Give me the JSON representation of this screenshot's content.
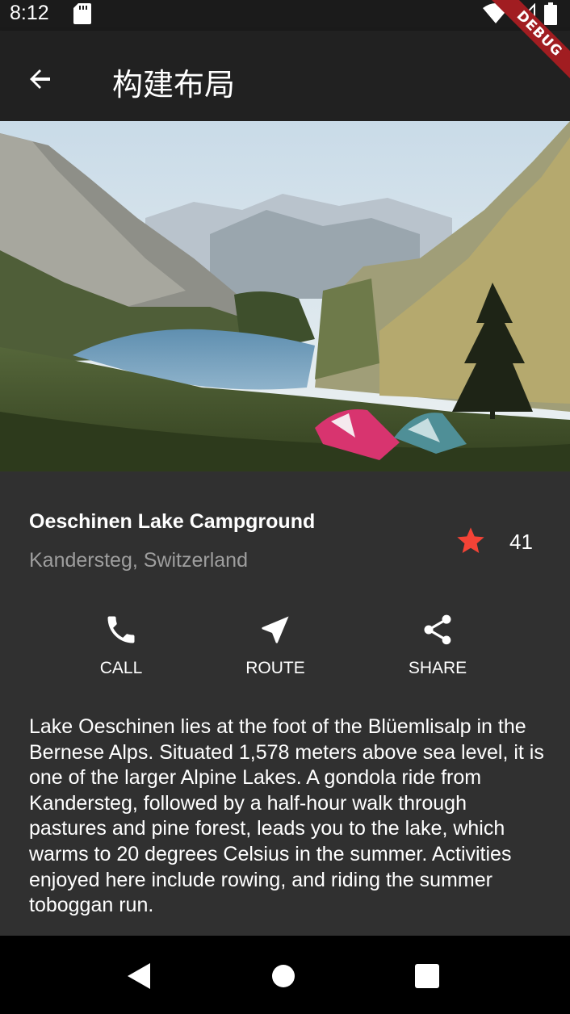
{
  "status_bar": {
    "time": "8:12"
  },
  "app_bar": {
    "title": "构建布局"
  },
  "debug_banner": {
    "label": "DEBUG"
  },
  "place": {
    "name": "Oeschinen Lake Campground",
    "location": "Kandersteg, Switzerland",
    "rating_count": "41",
    "star_color": "#f44336"
  },
  "actions": [
    {
      "label": "CALL",
      "icon": "phone-icon"
    },
    {
      "label": "ROUTE",
      "icon": "near-me-icon"
    },
    {
      "label": "SHARE",
      "icon": "share-icon"
    }
  ],
  "description": "Lake Oeschinen lies at the foot of the Blüemlisalp in the Bernese Alps. Situated 1,578 meters above sea level, it is one of the larger Alpine Lakes. A gondola ride from Kandersteg, followed by a half-hour walk through pastures and pine forest, leads you to the lake, which warms to 20 degrees Celsius in the summer. Activities enjoyed here include rowing, and riding the summer toboggan run."
}
